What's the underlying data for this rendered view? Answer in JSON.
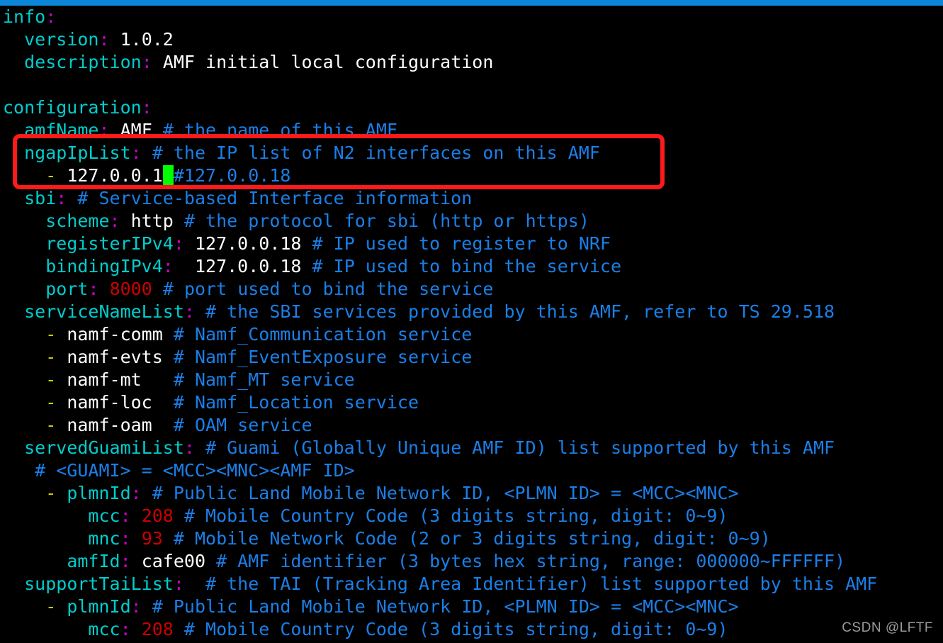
{
  "window": {
    "accent_bar_color": "#0b86d8",
    "background_color": "#000000"
  },
  "annotation": {
    "highlight_box_color": "#ff1a1a",
    "highlight_target": "ngapIpList block"
  },
  "cursor": {
    "color": "#00ff00",
    "char": " "
  },
  "watermark": {
    "text": "CSDN @LFTF"
  },
  "colors": {
    "key": "#00cdcd",
    "colon": "#cd00cd",
    "comment": "#1a7fe8",
    "string": "#ffffff",
    "number": "#cd0000",
    "dash": "#cdcd00"
  },
  "editor": {
    "lines": [
      {
        "id": "l01",
        "indent": 0,
        "key": "info",
        "value": "",
        "comment": ""
      },
      {
        "id": "l02",
        "indent": 2,
        "key": "version",
        "value": "1.0.2",
        "value_type": "string",
        "comment": ""
      },
      {
        "id": "l03",
        "indent": 2,
        "key": "description",
        "value": "AMF initial local configuration",
        "value_type": "string",
        "comment": ""
      },
      {
        "id": "l04",
        "indent": 0,
        "key": "",
        "value": "",
        "comment": ""
      },
      {
        "id": "l05",
        "indent": 0,
        "key": "configuration",
        "value": "",
        "comment": ""
      },
      {
        "id": "l06",
        "indent": 2,
        "key": "amfName",
        "value": "AMF",
        "value_type": "string",
        "comment": "# the name of this AMF"
      },
      {
        "id": "l07",
        "indent": 2,
        "key": "ngapIpList",
        "value": "",
        "comment": "# the IP list of N2 interfaces on this AMF"
      },
      {
        "id": "l08",
        "indent": 4,
        "dash": true,
        "value": "127.0.0.1",
        "value_type": "string",
        "cursor_after": true,
        "comment": "#127.0.0.18"
      },
      {
        "id": "l09",
        "indent": 2,
        "key": "sbi",
        "value": "",
        "comment": "# Service-based Interface information"
      },
      {
        "id": "l10",
        "indent": 4,
        "key": "scheme",
        "value": "http",
        "value_type": "string",
        "comment": "# the protocol for sbi (http or https)"
      },
      {
        "id": "l11",
        "indent": 4,
        "key": "registerIPv4",
        "value": "127.0.0.18",
        "value_type": "string",
        "comment": "# IP used to register to NRF"
      },
      {
        "id": "l12",
        "indent": 4,
        "key": "bindingIPv4",
        "value": "127.0.0.18",
        "value_type": "string",
        "extra_space": true,
        "comment": "# IP used to bind the service"
      },
      {
        "id": "l13",
        "indent": 4,
        "key": "port",
        "value": "8000",
        "value_type": "number",
        "comment": "# port used to bind the service"
      },
      {
        "id": "l14",
        "indent": 2,
        "key": "serviceNameList",
        "value": "",
        "comment": "# the SBI services provided by this AMF, refer to TS 29.518"
      },
      {
        "id": "l15",
        "indent": 4,
        "dash": true,
        "value": "namf-comm",
        "value_type": "string",
        "comment": "# Namf_Communication service"
      },
      {
        "id": "l16",
        "indent": 4,
        "dash": true,
        "value": "namf-evts",
        "value_type": "string",
        "comment": "# Namf_EventExposure service"
      },
      {
        "id": "l17",
        "indent": 4,
        "dash": true,
        "value": "namf-mt",
        "value_type": "string",
        "pad": 2,
        "comment": "# Namf_MT service"
      },
      {
        "id": "l18",
        "indent": 4,
        "dash": true,
        "value": "namf-loc",
        "value_type": "string",
        "pad": 1,
        "comment": "# Namf_Location service"
      },
      {
        "id": "l19",
        "indent": 4,
        "dash": true,
        "value": "namf-oam",
        "value_type": "string",
        "pad": 1,
        "comment": "# OAM service"
      },
      {
        "id": "l20",
        "indent": 2,
        "key": "servedGuamiList",
        "value": "",
        "comment": "# Guami (Globally Unique AMF ID) list supported by this AMF"
      },
      {
        "id": "l21",
        "indent": 3,
        "comment_only": true,
        "comment": "# <GUAMI> = <MCC><MNC><AMF ID>"
      },
      {
        "id": "l22",
        "indent": 4,
        "dash": true,
        "key": "plmnId",
        "value": "",
        "comment": "# Public Land Mobile Network ID, <PLMN ID> = <MCC><MNC>"
      },
      {
        "id": "l23",
        "indent": 8,
        "key": "mcc",
        "value": "208",
        "value_type": "number",
        "comment": "# Mobile Country Code (3 digits string, digit: 0~9)"
      },
      {
        "id": "l24",
        "indent": 8,
        "key": "mnc",
        "value": "93",
        "value_type": "number",
        "comment": "# Mobile Network Code (2 or 3 digits string, digit: 0~9)"
      },
      {
        "id": "l25",
        "indent": 6,
        "key": "amfId",
        "value": "cafe00",
        "value_type": "string",
        "comment": "# AMF identifier (3 bytes hex string, range: 000000~FFFFFF)"
      },
      {
        "id": "l26",
        "indent": 2,
        "key": "supportTaiList",
        "value": "",
        "extra_space": true,
        "comment": "# the TAI (Tracking Area Identifier) list supported by this AMF"
      },
      {
        "id": "l27",
        "indent": 4,
        "dash": true,
        "key": "plmnId",
        "value": "",
        "comment": "# Public Land Mobile Network ID, <PLMN ID> = <MCC><MNC>"
      },
      {
        "id": "l28",
        "indent": 8,
        "key": "mcc",
        "value": "208",
        "value_type": "number",
        "comment": "# Mobile Country Code (3 digits string, digit: 0~9)"
      }
    ]
  }
}
